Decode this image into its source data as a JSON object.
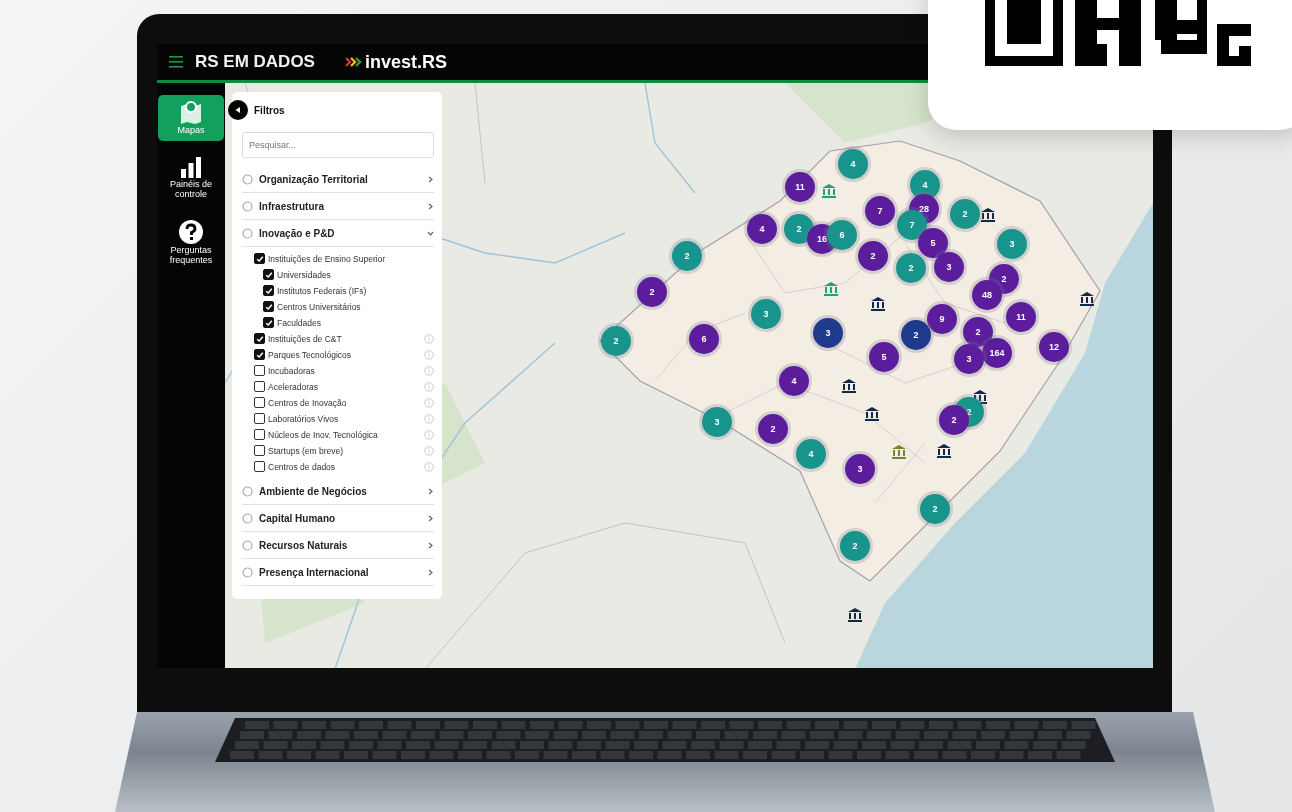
{
  "header": {
    "title": "RS EM DADOS",
    "brand": "invest.RS"
  },
  "nav": [
    {
      "label": "Mapas",
      "selected": true
    },
    {
      "label": "Painéis de controle",
      "selected": false
    },
    {
      "label": "Perguntas frequentes",
      "selected": false
    }
  ],
  "filters": {
    "title": "Filtros",
    "search": {
      "placeholder": "Pesquisar..."
    },
    "sections": [
      {
        "label": "Organização Territorial",
        "expanded": false
      },
      {
        "label": "Infraestrutura",
        "expanded": false
      },
      {
        "label": "Inovação e P&D",
        "expanded": true,
        "items": [
          {
            "label": "Instituições de Ensino Superior",
            "checked": true,
            "info": false,
            "children": [
              {
                "label": "Universidades",
                "checked": true
              },
              {
                "label": "Institutos Federais (IFs)",
                "checked": true
              },
              {
                "label": "Centros Universitários",
                "checked": true
              },
              {
                "label": "Faculdades",
                "checked": true
              }
            ]
          },
          {
            "label": "Instituições de C&T",
            "checked": true,
            "info": true
          },
          {
            "label": "Parques Tecnológicos",
            "checked": true,
            "info": true
          },
          {
            "label": "Incubadoras",
            "checked": false,
            "info": true
          },
          {
            "label": "Aceleradoras",
            "checked": false,
            "info": true
          },
          {
            "label": "Centros de Inovação",
            "checked": false,
            "info": true
          },
          {
            "label": "Laboratórios Vivos",
            "checked": false,
            "info": true
          },
          {
            "label": "Núcleos de Inov. Tecnológica",
            "checked": false,
            "info": true
          },
          {
            "label": "Startups (em breve)",
            "checked": false,
            "info": true
          },
          {
            "label": "Centros de dados",
            "checked": false,
            "info": true
          }
        ]
      },
      {
        "label": "Ambiente de Negócios",
        "expanded": false
      },
      {
        "label": "Capital Humano",
        "expanded": false
      },
      {
        "label": "Recursos Naturais",
        "expanded": false
      },
      {
        "label": "Presença Internacional",
        "expanded": false
      }
    ]
  },
  "clusters": [
    {
      "count": "4",
      "color": "#17958d"
    },
    {
      "count": "11",
      "color": "#5c1d9c"
    },
    {
      "count": "4",
      "color": "#17958d"
    },
    {
      "count": "7",
      "color": "#5c1d9c"
    },
    {
      "count": "28",
      "color": "#5c1d9c"
    },
    {
      "count": "2",
      "color": "#17958d"
    },
    {
      "count": "4",
      "color": "#5c1d9c"
    },
    {
      "count": "2",
      "color": "#17958d"
    },
    {
      "count": "16",
      "color": "#5c1d9c"
    },
    {
      "count": "6",
      "color": "#17958d"
    },
    {
      "count": "7",
      "color": "#17958d"
    },
    {
      "count": "5",
      "color": "#5c1d9c"
    },
    {
      "count": "3",
      "color": "#17958d"
    },
    {
      "count": "2",
      "color": "#17958d"
    },
    {
      "count": "2",
      "color": "#5c1d9c"
    },
    {
      "count": "2",
      "color": "#17958d"
    },
    {
      "count": "3",
      "color": "#5c1d9c"
    },
    {
      "count": "2",
      "color": "#5c1d9c"
    },
    {
      "count": "48",
      "color": "#5c1d9c"
    },
    {
      "count": "2",
      "color": "#5c1d9c"
    },
    {
      "count": "3",
      "color": "#17958d"
    },
    {
      "count": "9",
      "color": "#5c1d9c"
    },
    {
      "count": "11",
      "color": "#5c1d9c"
    },
    {
      "count": "2",
      "color": "#17958d"
    },
    {
      "count": "6",
      "color": "#5c1d9c"
    },
    {
      "count": "3",
      "color": "#1f3a8c"
    },
    {
      "count": "2",
      "color": "#1f3a8c"
    },
    {
      "count": "2",
      "color": "#5c1d9c"
    },
    {
      "count": "164",
      "color": "#5c1d9c"
    },
    {
      "count": "3",
      "color": "#5c1d9c"
    },
    {
      "count": "12",
      "color": "#5c1d9c"
    },
    {
      "count": "5",
      "color": "#5c1d9c"
    },
    {
      "count": "4",
      "color": "#5c1d9c"
    },
    {
      "count": "3",
      "color": "#17958d"
    },
    {
      "count": "2",
      "color": "#5c1d9c"
    },
    {
      "count": "2",
      "color": "#17958d"
    },
    {
      "count": "2",
      "color": "#5c1d9c"
    },
    {
      "count": "4",
      "color": "#17958d"
    },
    {
      "count": "3",
      "color": "#5c1d9c"
    },
    {
      "count": "2",
      "color": "#17958d"
    },
    {
      "count": "2",
      "color": "#17958d"
    }
  ]
}
